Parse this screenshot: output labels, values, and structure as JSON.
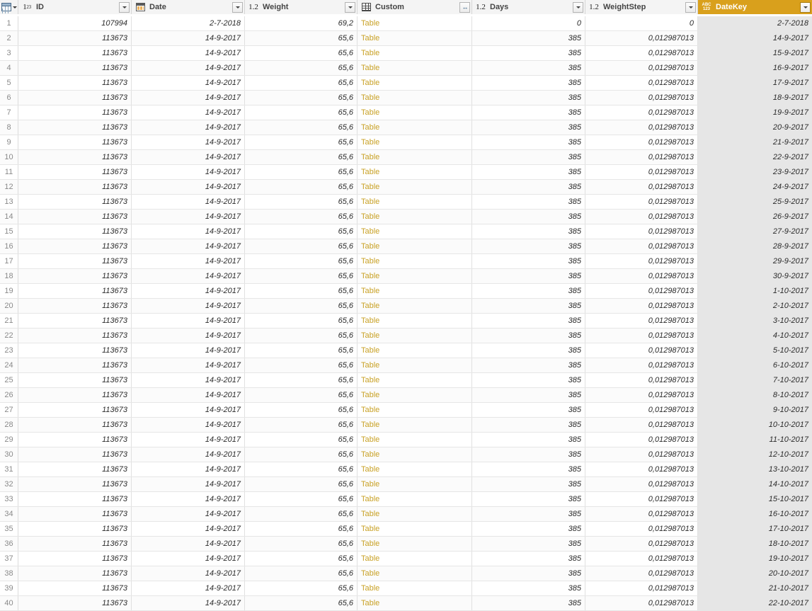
{
  "grid": {
    "corner": {
      "icon": "table-select-icon",
      "has_dropdown": true
    },
    "columns": [
      {
        "name": "ID",
        "type_icon": "whole-number-icon",
        "icon_label": "1²₃",
        "button": "dropdown",
        "selected": false
      },
      {
        "name": "Date",
        "type_icon": "date-icon",
        "icon_label": "",
        "button": "dropdown",
        "selected": false
      },
      {
        "name": "Weight",
        "type_icon": "decimal-number-icon",
        "icon_label": "1.2",
        "button": "dropdown",
        "selected": false
      },
      {
        "name": "Custom",
        "type_icon": "table-icon",
        "icon_label": "",
        "button": "expand",
        "selected": false
      },
      {
        "name": "Days",
        "type_icon": "decimal-number-icon",
        "icon_label": "1.2",
        "button": "dropdown",
        "selected": false
      },
      {
        "name": "WeightStep",
        "type_icon": "decimal-number-icon",
        "icon_label": "1.2",
        "button": "dropdown",
        "selected": false
      },
      {
        "name": "DateKey",
        "type_icon": "any-type-icon",
        "icon_label": "ABC123",
        "button": "dropdown",
        "selected": true
      }
    ],
    "selected_column": "DateKey",
    "selected_header_color": "#d9a01c",
    "header_underline_color": "#00a2b5",
    "table_value_color": "#c9a227",
    "rows": [
      {
        "n": "1",
        "ID": "107994",
        "Date": "2-7-2018",
        "Weight": "69,2",
        "Custom": "Table",
        "Days": "0",
        "WeightStep": "0",
        "DateKey": "2-7-2018"
      },
      {
        "n": "2",
        "ID": "113673",
        "Date": "14-9-2017",
        "Weight": "65,6",
        "Custom": "Table",
        "Days": "385",
        "WeightStep": "0,012987013",
        "DateKey": "14-9-2017"
      },
      {
        "n": "3",
        "ID": "113673",
        "Date": "14-9-2017",
        "Weight": "65,6",
        "Custom": "Table",
        "Days": "385",
        "WeightStep": "0,012987013",
        "DateKey": "15-9-2017"
      },
      {
        "n": "4",
        "ID": "113673",
        "Date": "14-9-2017",
        "Weight": "65,6",
        "Custom": "Table",
        "Days": "385",
        "WeightStep": "0,012987013",
        "DateKey": "16-9-2017"
      },
      {
        "n": "5",
        "ID": "113673",
        "Date": "14-9-2017",
        "Weight": "65,6",
        "Custom": "Table",
        "Days": "385",
        "WeightStep": "0,012987013",
        "DateKey": "17-9-2017"
      },
      {
        "n": "6",
        "ID": "113673",
        "Date": "14-9-2017",
        "Weight": "65,6",
        "Custom": "Table",
        "Days": "385",
        "WeightStep": "0,012987013",
        "DateKey": "18-9-2017"
      },
      {
        "n": "7",
        "ID": "113673",
        "Date": "14-9-2017",
        "Weight": "65,6",
        "Custom": "Table",
        "Days": "385",
        "WeightStep": "0,012987013",
        "DateKey": "19-9-2017"
      },
      {
        "n": "8",
        "ID": "113673",
        "Date": "14-9-2017",
        "Weight": "65,6",
        "Custom": "Table",
        "Days": "385",
        "WeightStep": "0,012987013",
        "DateKey": "20-9-2017"
      },
      {
        "n": "9",
        "ID": "113673",
        "Date": "14-9-2017",
        "Weight": "65,6",
        "Custom": "Table",
        "Days": "385",
        "WeightStep": "0,012987013",
        "DateKey": "21-9-2017"
      },
      {
        "n": "10",
        "ID": "113673",
        "Date": "14-9-2017",
        "Weight": "65,6",
        "Custom": "Table",
        "Days": "385",
        "WeightStep": "0,012987013",
        "DateKey": "22-9-2017"
      },
      {
        "n": "11",
        "ID": "113673",
        "Date": "14-9-2017",
        "Weight": "65,6",
        "Custom": "Table",
        "Days": "385",
        "WeightStep": "0,012987013",
        "DateKey": "23-9-2017"
      },
      {
        "n": "12",
        "ID": "113673",
        "Date": "14-9-2017",
        "Weight": "65,6",
        "Custom": "Table",
        "Days": "385",
        "WeightStep": "0,012987013",
        "DateKey": "24-9-2017"
      },
      {
        "n": "13",
        "ID": "113673",
        "Date": "14-9-2017",
        "Weight": "65,6",
        "Custom": "Table",
        "Days": "385",
        "WeightStep": "0,012987013",
        "DateKey": "25-9-2017"
      },
      {
        "n": "14",
        "ID": "113673",
        "Date": "14-9-2017",
        "Weight": "65,6",
        "Custom": "Table",
        "Days": "385",
        "WeightStep": "0,012987013",
        "DateKey": "26-9-2017"
      },
      {
        "n": "15",
        "ID": "113673",
        "Date": "14-9-2017",
        "Weight": "65,6",
        "Custom": "Table",
        "Days": "385",
        "WeightStep": "0,012987013",
        "DateKey": "27-9-2017"
      },
      {
        "n": "16",
        "ID": "113673",
        "Date": "14-9-2017",
        "Weight": "65,6",
        "Custom": "Table",
        "Days": "385",
        "WeightStep": "0,012987013",
        "DateKey": "28-9-2017"
      },
      {
        "n": "17",
        "ID": "113673",
        "Date": "14-9-2017",
        "Weight": "65,6",
        "Custom": "Table",
        "Days": "385",
        "WeightStep": "0,012987013",
        "DateKey": "29-9-2017"
      },
      {
        "n": "18",
        "ID": "113673",
        "Date": "14-9-2017",
        "Weight": "65,6",
        "Custom": "Table",
        "Days": "385",
        "WeightStep": "0,012987013",
        "DateKey": "30-9-2017"
      },
      {
        "n": "19",
        "ID": "113673",
        "Date": "14-9-2017",
        "Weight": "65,6",
        "Custom": "Table",
        "Days": "385",
        "WeightStep": "0,012987013",
        "DateKey": "1-10-2017"
      },
      {
        "n": "20",
        "ID": "113673",
        "Date": "14-9-2017",
        "Weight": "65,6",
        "Custom": "Table",
        "Days": "385",
        "WeightStep": "0,012987013",
        "DateKey": "2-10-2017"
      },
      {
        "n": "21",
        "ID": "113673",
        "Date": "14-9-2017",
        "Weight": "65,6",
        "Custom": "Table",
        "Days": "385",
        "WeightStep": "0,012987013",
        "DateKey": "3-10-2017"
      },
      {
        "n": "22",
        "ID": "113673",
        "Date": "14-9-2017",
        "Weight": "65,6",
        "Custom": "Table",
        "Days": "385",
        "WeightStep": "0,012987013",
        "DateKey": "4-10-2017"
      },
      {
        "n": "23",
        "ID": "113673",
        "Date": "14-9-2017",
        "Weight": "65,6",
        "Custom": "Table",
        "Days": "385",
        "WeightStep": "0,012987013",
        "DateKey": "5-10-2017"
      },
      {
        "n": "24",
        "ID": "113673",
        "Date": "14-9-2017",
        "Weight": "65,6",
        "Custom": "Table",
        "Days": "385",
        "WeightStep": "0,012987013",
        "DateKey": "6-10-2017"
      },
      {
        "n": "25",
        "ID": "113673",
        "Date": "14-9-2017",
        "Weight": "65,6",
        "Custom": "Table",
        "Days": "385",
        "WeightStep": "0,012987013",
        "DateKey": "7-10-2017"
      },
      {
        "n": "26",
        "ID": "113673",
        "Date": "14-9-2017",
        "Weight": "65,6",
        "Custom": "Table",
        "Days": "385",
        "WeightStep": "0,012987013",
        "DateKey": "8-10-2017"
      },
      {
        "n": "27",
        "ID": "113673",
        "Date": "14-9-2017",
        "Weight": "65,6",
        "Custom": "Table",
        "Days": "385",
        "WeightStep": "0,012987013",
        "DateKey": "9-10-2017"
      },
      {
        "n": "28",
        "ID": "113673",
        "Date": "14-9-2017",
        "Weight": "65,6",
        "Custom": "Table",
        "Days": "385",
        "WeightStep": "0,012987013",
        "DateKey": "10-10-2017"
      },
      {
        "n": "29",
        "ID": "113673",
        "Date": "14-9-2017",
        "Weight": "65,6",
        "Custom": "Table",
        "Days": "385",
        "WeightStep": "0,012987013",
        "DateKey": "11-10-2017"
      },
      {
        "n": "30",
        "ID": "113673",
        "Date": "14-9-2017",
        "Weight": "65,6",
        "Custom": "Table",
        "Days": "385",
        "WeightStep": "0,012987013",
        "DateKey": "12-10-2017"
      },
      {
        "n": "31",
        "ID": "113673",
        "Date": "14-9-2017",
        "Weight": "65,6",
        "Custom": "Table",
        "Days": "385",
        "WeightStep": "0,012987013",
        "DateKey": "13-10-2017"
      },
      {
        "n": "32",
        "ID": "113673",
        "Date": "14-9-2017",
        "Weight": "65,6",
        "Custom": "Table",
        "Days": "385",
        "WeightStep": "0,012987013",
        "DateKey": "14-10-2017"
      },
      {
        "n": "33",
        "ID": "113673",
        "Date": "14-9-2017",
        "Weight": "65,6",
        "Custom": "Table",
        "Days": "385",
        "WeightStep": "0,012987013",
        "DateKey": "15-10-2017"
      },
      {
        "n": "34",
        "ID": "113673",
        "Date": "14-9-2017",
        "Weight": "65,6",
        "Custom": "Table",
        "Days": "385",
        "WeightStep": "0,012987013",
        "DateKey": "16-10-2017"
      },
      {
        "n": "35",
        "ID": "113673",
        "Date": "14-9-2017",
        "Weight": "65,6",
        "Custom": "Table",
        "Days": "385",
        "WeightStep": "0,012987013",
        "DateKey": "17-10-2017"
      },
      {
        "n": "36",
        "ID": "113673",
        "Date": "14-9-2017",
        "Weight": "65,6",
        "Custom": "Table",
        "Days": "385",
        "WeightStep": "0,012987013",
        "DateKey": "18-10-2017"
      },
      {
        "n": "37",
        "ID": "113673",
        "Date": "14-9-2017",
        "Weight": "65,6",
        "Custom": "Table",
        "Days": "385",
        "WeightStep": "0,012987013",
        "DateKey": "19-10-2017"
      },
      {
        "n": "38",
        "ID": "113673",
        "Date": "14-9-2017",
        "Weight": "65,6",
        "Custom": "Table",
        "Days": "385",
        "WeightStep": "0,012987013",
        "DateKey": "20-10-2017"
      },
      {
        "n": "39",
        "ID": "113673",
        "Date": "14-9-2017",
        "Weight": "65,6",
        "Custom": "Table",
        "Days": "385",
        "WeightStep": "0,012987013",
        "DateKey": "21-10-2017"
      },
      {
        "n": "40",
        "ID": "113673",
        "Date": "14-9-2017",
        "Weight": "65,6",
        "Custom": "Table",
        "Days": "385",
        "WeightStep": "0,012987013",
        "DateKey": "22-10-2017"
      }
    ]
  }
}
